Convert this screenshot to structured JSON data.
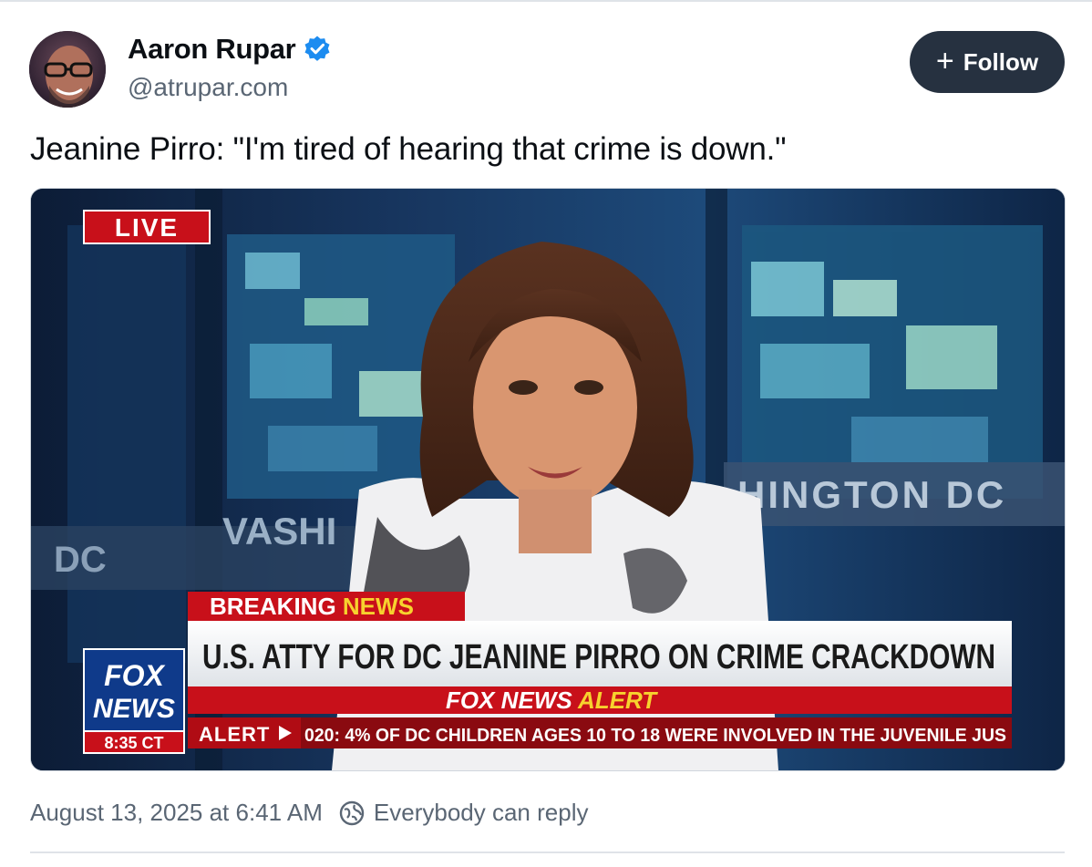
{
  "author": {
    "name": "Aaron Rupar",
    "handle": "@atrupar.com",
    "verified": true
  },
  "follow_button": {
    "label": "Follow",
    "icon": "plus-icon"
  },
  "post": {
    "text": "Jeanine Pirro: \"I'm tired of hearing that crime is down.\"",
    "timestamp": "August 13, 2025 at 6:41 AM",
    "reply_setting": "Everybody can reply"
  },
  "video": {
    "live_badge": "LIVE",
    "background_text_right": "HINGTON DC",
    "background_text_left": "VASHI",
    "background_text_far_left": "DC",
    "breaking_label_part1": "BREAKING ",
    "breaking_label_part2": "NEWS",
    "headline": "U.S. ATTY FOR DC JEANINE PIRRO ON CRIME CRACKDOWN",
    "alert_label_part1": "FOX NEWS ",
    "alert_label_part2": "ALERT",
    "ticker_label": "ALERT",
    "ticker_text": "020: 4% OF DC CHILDREN AGES 10 TO 18 WERE INVOLVED IN THE JUVENILE JUS",
    "logo_line1": "FOX",
    "logo_line2": "NEWS",
    "clock": "8:35 CT"
  },
  "colors": {
    "follow_bg": "#263140",
    "verified_blue": "#1d8cf0",
    "secondary_text": "#5a6674",
    "fox_red": "#c8101a",
    "fox_yellow": "#f7d22e"
  }
}
